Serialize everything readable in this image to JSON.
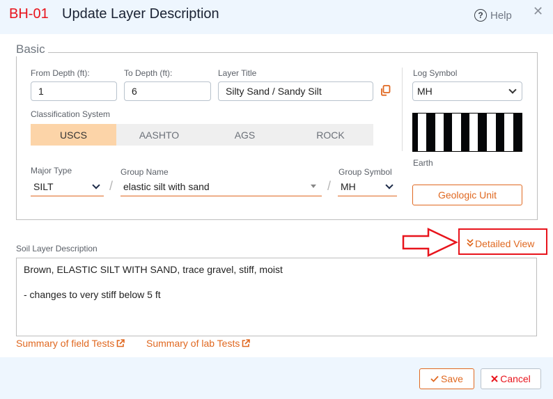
{
  "header": {
    "borehole_id": "BH-01",
    "title": "Update Layer Description",
    "help_label": "Help",
    "help_icon": "question-circle-icon",
    "close_icon": "close-icon",
    "close_glyph": "✕"
  },
  "basic": {
    "legend": "Basic",
    "from_depth": {
      "label": "From Depth (ft):",
      "value": "1"
    },
    "to_depth": {
      "label": "To Depth (ft):",
      "value": "6"
    },
    "layer_title": {
      "label": "Layer Title",
      "value": "Silty Sand / Sandy Silt"
    },
    "copy_icon": "copy-icon",
    "classification": {
      "label": "Classification System",
      "options": [
        "USCS",
        "AASHTO",
        "AGS",
        "ROCK"
      ],
      "selected": "USCS"
    },
    "major_type": {
      "label": "Major Type",
      "value": "SILT"
    },
    "group_name": {
      "label": "Group Name",
      "value": "elastic silt with sand"
    },
    "group_symbol": {
      "label": "Group Symbol",
      "value": "MH"
    },
    "separator": "/",
    "log_symbol": {
      "label": "Log Symbol",
      "value": "MH",
      "pattern_caption": "Earth"
    },
    "geologic_unit_label": "Geologic Unit"
  },
  "description": {
    "label": "Soil Layer Description",
    "value": "Brown, ELASTIC SILT WITH SAND, trace gravel, stiff, moist\n\n- changes to very stiff below 5 ft",
    "detailed_view_label": "Detailed View",
    "annotation_color": "#e8141c"
  },
  "links": {
    "field_tests": "Summary of field Tests",
    "lab_tests": "Summary of lab Tests"
  },
  "footer": {
    "save_label": "Save",
    "cancel_label": "Cancel"
  },
  "colors": {
    "accent": "#e06820",
    "id_red": "#e8141c",
    "header_bg": "#eef6fe",
    "active_segment": "#fcd4a8"
  }
}
